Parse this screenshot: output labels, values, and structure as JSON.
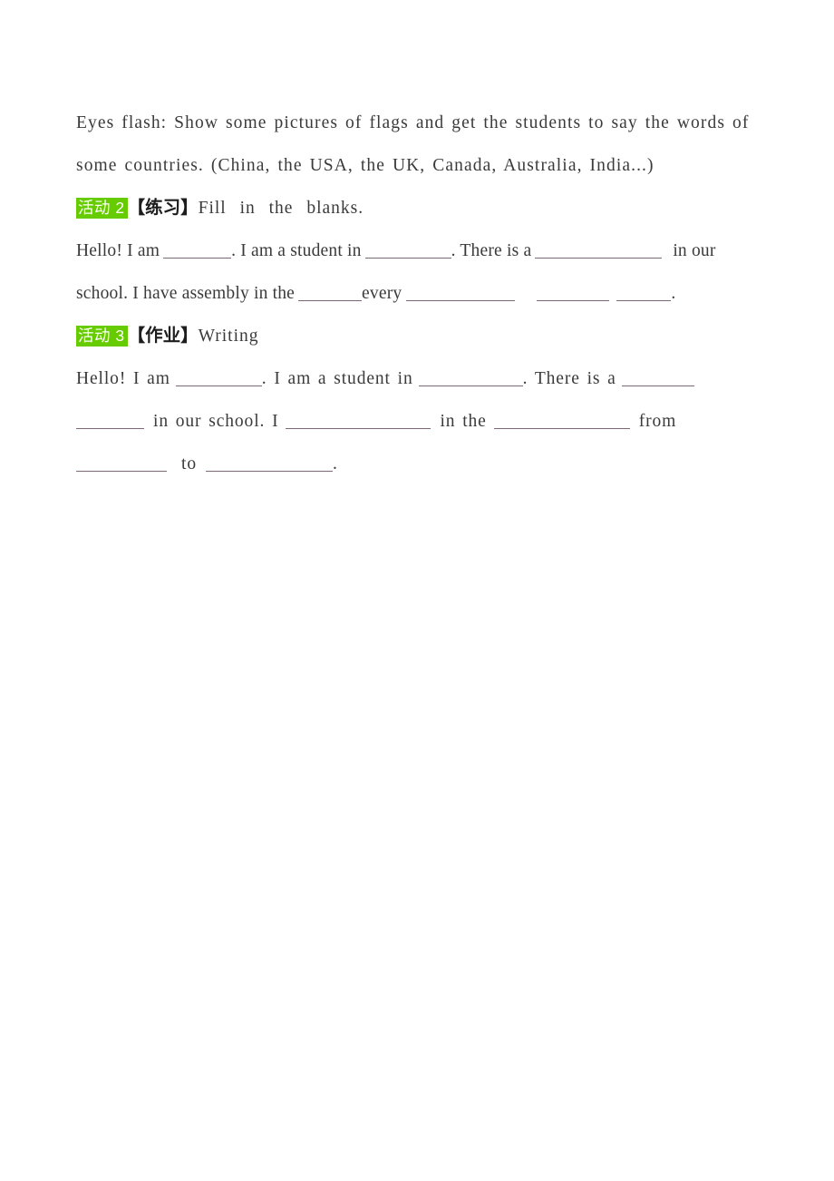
{
  "document": {
    "page_background": "#ffffff",
    "text_color": "#3a3a3a",
    "highlight_color": "#66cc00",
    "highlight_text_color": "#ffffff",
    "blank_rule_color": "#7b6a76"
  },
  "intro": {
    "text": "Eyes flash: Show some pictures of flags and get the students to say the words of some countries. (China, the USA, the UK, Canada, Australia, India...)"
  },
  "activity_2": {
    "badge": "活动 2",
    "bracket": "【练习】",
    "title": "Fill  in  the  blanks.",
    "body": {
      "seg_1": "Hello! I am",
      "seg_2": ". I am a student in",
      "seg_3": ". There is a",
      "seg_4": "in our school. I have assembly in the",
      "seg_5": "every",
      "seg_6": ".",
      "blank_widths": [
        75,
        95,
        140,
        70,
        120,
        80,
        60
      ]
    }
  },
  "activity_3": {
    "badge": "活动 3",
    "bracket": "【作业】",
    "title": "Writing",
    "body": {
      "seg_1": "Hello! I am",
      "seg_2": ". I am a student in",
      "seg_3": ". There is a",
      "seg_4": "in our school.  I",
      "seg_5": "in the",
      "seg_6": "from",
      "seg_7": "to",
      "seg_8": ".",
      "blank_widths": [
        95,
        115,
        80,
        75,
        160,
        150,
        100,
        140
      ]
    }
  }
}
